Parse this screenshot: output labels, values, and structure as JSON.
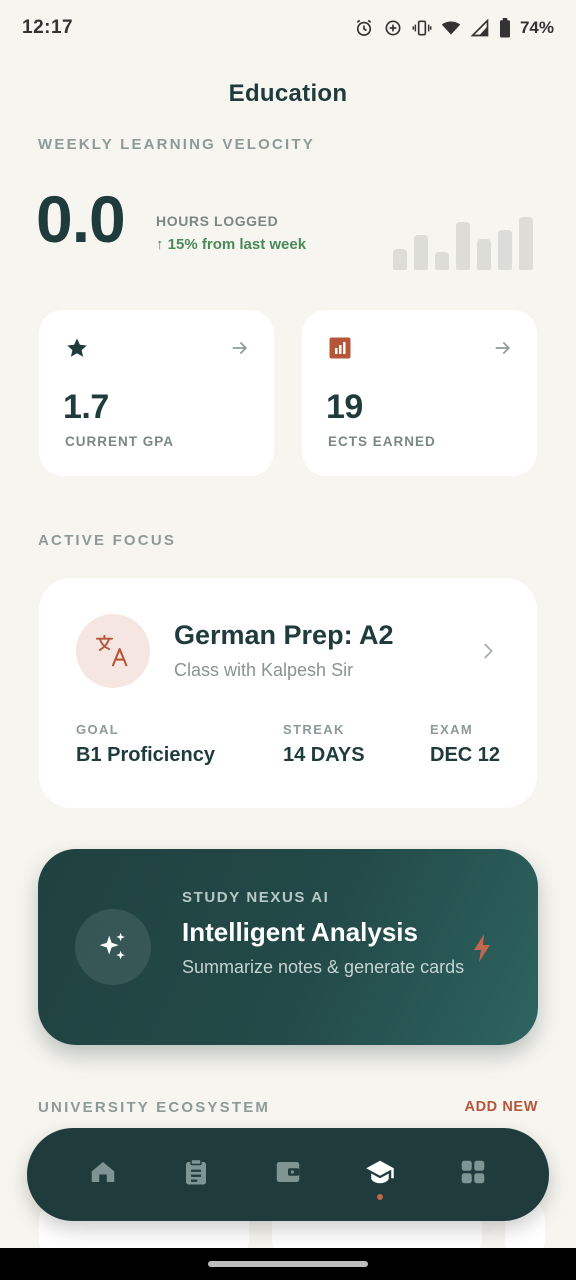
{
  "status_bar": {
    "time": "12:17",
    "battery": "74%"
  },
  "header": {
    "title": "Education"
  },
  "velocity": {
    "section_label": "WEEKLY LEARNING VELOCITY",
    "value": "0.0",
    "unit_label": "HOURS LOGGED",
    "trend": "↑ 15% from last week",
    "bar_levels": [
      0.38,
      0.62,
      0.32,
      0.85,
      0.55,
      0.72,
      0.95
    ]
  },
  "stats": [
    {
      "value": "1.7",
      "label": "CURRENT GPA",
      "icon": "star-icon"
    },
    {
      "value": "19",
      "label": "ECTS EARNED",
      "icon": "chart-icon"
    }
  ],
  "focus": {
    "section_label": "ACTIVE FOCUS",
    "title": "German Prep: A2",
    "subtitle": "Class with Kalpesh Sir",
    "icon": "translate-icon",
    "meta": [
      {
        "label": "GOAL",
        "value": "B1 Proficiency"
      },
      {
        "label": "STREAK",
        "value": "14 DAYS"
      },
      {
        "label": "EXAM",
        "value": "DEC 12"
      }
    ]
  },
  "ai": {
    "eyebrow": "STUDY NEXUS AI",
    "title": "Intelligent Analysis",
    "description": "Summarize notes & generate cards",
    "icon": "sparkle-icon",
    "action_icon": "bolt-icon"
  },
  "ecosystem": {
    "section_label": "UNIVERSITY ECOSYSTEM",
    "action": "ADD NEW"
  },
  "nav": {
    "items": [
      "home-icon",
      "clipboard-icon",
      "wallet-icon",
      "graduation-cap-icon",
      "grid-icon"
    ],
    "active_index": 3
  },
  "colors": {
    "primary": "#1f3b3b",
    "accent": "#b5553a",
    "positive": "#4a8a5a",
    "background": "#f7f5f0"
  }
}
